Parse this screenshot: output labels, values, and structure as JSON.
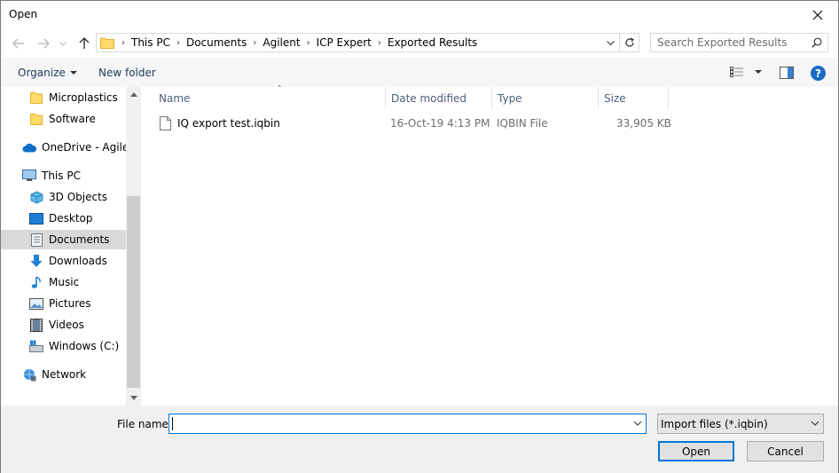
{
  "window": {
    "title": "Open"
  },
  "address": {
    "crumbs": [
      "This PC",
      "Documents",
      "Agilent",
      "ICP Expert",
      "Exported Results"
    ],
    "search_placeholder": "Search Exported Results"
  },
  "toolbar": {
    "organize_label": "Organize",
    "new_folder_label": "New folder",
    "help_label": "?"
  },
  "navpane": {
    "items": [
      {
        "label": "Microplastics",
        "icon": "folder-icon"
      },
      {
        "label": "Software",
        "icon": "folder-icon"
      },
      {
        "label": "OneDrive - Agilen",
        "icon": "cloud-icon"
      },
      {
        "label": "This PC",
        "icon": "computer-icon"
      },
      {
        "label": "3D Objects",
        "icon": "cube-icon"
      },
      {
        "label": "Desktop",
        "icon": "desktop-icon"
      },
      {
        "label": "Documents",
        "icon": "documents-icon",
        "selected": true
      },
      {
        "label": "Downloads",
        "icon": "download-icon"
      },
      {
        "label": "Music",
        "icon": "music-icon"
      },
      {
        "label": "Pictures",
        "icon": "pictures-icon"
      },
      {
        "label": "Videos",
        "icon": "videos-icon"
      },
      {
        "label": "Windows (C:)",
        "icon": "drive-icon"
      },
      {
        "label": "Network",
        "icon": "network-icon"
      }
    ]
  },
  "filelist": {
    "columns": [
      "Name",
      "Date modified",
      "Type",
      "Size"
    ],
    "rows": [
      {
        "name": "IQ export test.iqbin",
        "date": "16-Oct-19 4:13 PM",
        "type": "IQBIN File",
        "size": "33,905 KB"
      }
    ]
  },
  "bottom": {
    "filename_label": "File name:",
    "filename_value": "",
    "filter_value": "Import files (*.iqbin)",
    "open_label": "Open",
    "cancel_label": "Cancel"
  }
}
